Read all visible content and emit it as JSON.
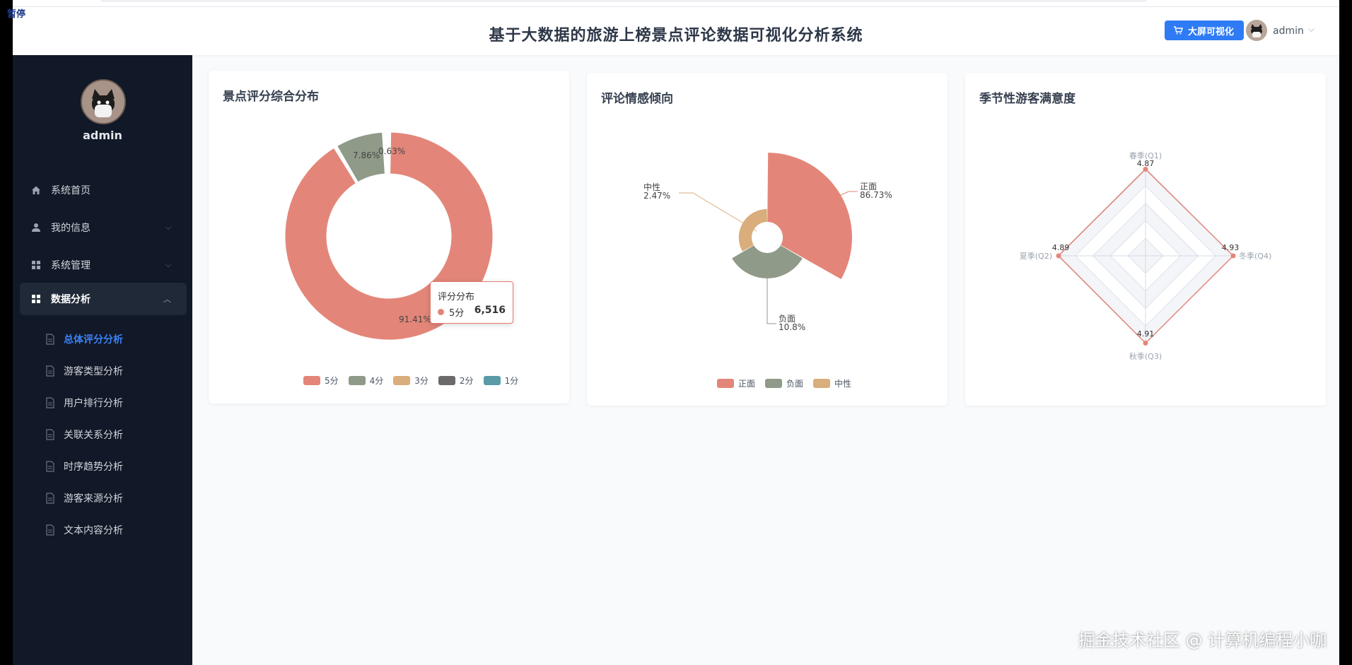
{
  "header": {
    "title": "基于大数据的旅游上榜景点评论数据可视化分析系统",
    "bigscreen_label": "大屏可视化",
    "username": "admin"
  },
  "sidebar": {
    "username": "admin",
    "menu": [
      {
        "label": "系统首页",
        "icon": "home-icon"
      },
      {
        "label": "我的信息",
        "icon": "user-icon"
      },
      {
        "label": "系统管理",
        "icon": "grid-icon"
      },
      {
        "label": "数据分析",
        "icon": "grid-icon"
      }
    ],
    "submenu": [
      {
        "label": "总体评分分析"
      },
      {
        "label": "游客类型分析"
      },
      {
        "label": "用户排行分析"
      },
      {
        "label": "关联关系分析"
      },
      {
        "label": "时序趋势分析"
      },
      {
        "label": "游客来源分析"
      },
      {
        "label": "文本内容分析"
      }
    ]
  },
  "cards": {
    "rating": {
      "title": "景点评分综合分布"
    },
    "sentiment": {
      "title": "评论情感倾向"
    },
    "season": {
      "title": "季节性游客满意度"
    }
  },
  "tooltip": {
    "title": "评分分布",
    "label": "5分",
    "value": "6,516"
  },
  "chart_data": [
    {
      "type": "pie",
      "title": "景点评分综合分布",
      "categories": [
        "5分",
        "4分",
        "3分",
        "2分",
        "1分"
      ],
      "values": [
        91.41,
        7.86,
        0.63,
        0.05,
        0.05
      ],
      "value_labels": [
        "91.41%",
        "7.86%",
        "0.63%",
        "",
        ""
      ],
      "colors": [
        "#e38679",
        "#8f9a88",
        "#d9ad7c",
        "#6b6b6b",
        "#5b9aa7"
      ],
      "legend": "bottom"
    },
    {
      "type": "pie",
      "title": "评论情感倾向",
      "categories": [
        "正面",
        "负面",
        "中性"
      ],
      "values": [
        86.73,
        10.8,
        2.47
      ],
      "value_labels": [
        "86.73%",
        "10.8%",
        "2.47%"
      ],
      "colors": [
        "#e38679",
        "#8f9a88",
        "#d9ad7c"
      ],
      "legend": "bottom"
    },
    {
      "type": "radar",
      "title": "季节性游客满意度",
      "categories": [
        "春季(Q1)",
        "冬季(Q4)",
        "秋季(Q3)",
        "夏季(Q2)"
      ],
      "values": [
        4.87,
        4.93,
        4.91,
        4.89
      ],
      "value_labels": [
        "4.87",
        "4.93",
        "4.91",
        "4.89"
      ],
      "color": "#e38679"
    }
  ],
  "overlay": {
    "pause": "暂停",
    "watermark": "掘金技术社区 @ 计算机编程小咖"
  }
}
